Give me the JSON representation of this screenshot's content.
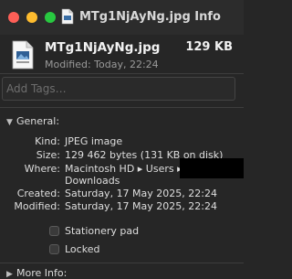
{
  "window": {
    "title": "MTg1NjAyNg.jpg Info"
  },
  "header": {
    "file_name": "MTg1NjAyNg.jpg",
    "file_size": "129 KB",
    "modified_summary": "Modified: Today, 22:24"
  },
  "tags": {
    "placeholder": "Add Tags…"
  },
  "general": {
    "title": "General:",
    "rows": [
      {
        "label": "Kind:",
        "value": "JPEG image"
      },
      {
        "label": "Size:",
        "value": "129 462 bytes (131 KB on disk)"
      },
      {
        "label": "Where:",
        "value": "Macintosh HD ▸ Users ▸",
        "value2": "Downloads"
      },
      {
        "label": "Created:",
        "value": "Saturday, 17 May 2025, 22:24"
      },
      {
        "label": "Modified:",
        "value": "Saturday, 17 May 2025, 22:24"
      }
    ],
    "stationery_label": "Stationery pad",
    "locked_label": "Locked"
  },
  "more_info": {
    "title": "More Info:"
  },
  "icons": [
    "jpeg-file-icon",
    "chevron-down-icon",
    "chevron-right-icon"
  ],
  "colors": {
    "close": "#fe5f57",
    "minimize": "#febc2e",
    "zoom": "#28c840",
    "background": "#262626"
  }
}
